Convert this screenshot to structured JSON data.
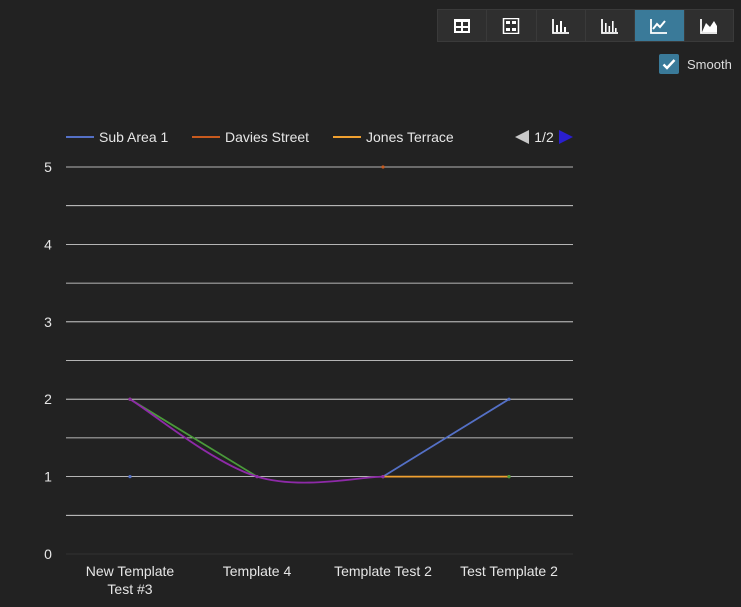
{
  "toolbar": {
    "buttons": [
      {
        "name": "table-view-button",
        "icon": "table-icon",
        "active": false
      },
      {
        "name": "pivot-view-button",
        "icon": "pivot-table-icon",
        "active": false
      },
      {
        "name": "bar-chart-button",
        "icon": "bar-chart-icon",
        "active": false
      },
      {
        "name": "column-chart-button",
        "icon": "column-chart-icon",
        "active": false
      },
      {
        "name": "line-chart-button",
        "icon": "line-chart-icon",
        "active": true
      },
      {
        "name": "area-chart-button",
        "icon": "area-chart-icon",
        "active": false
      }
    ],
    "active_color": "#3a7a99"
  },
  "smooth": {
    "label": "Smooth",
    "checked": true
  },
  "legend": {
    "page_label": "1/2"
  },
  "chart_data": {
    "type": "line",
    "title": "",
    "xlabel": "",
    "ylabel": "",
    "categories": [
      "New Template Test #3",
      "Template 4",
      "Template Test 2",
      "Test Template 2"
    ],
    "category_lines": [
      [
        "New Template",
        "Test #3"
      ],
      [
        "Template 4"
      ],
      [
        "Template Test 2"
      ],
      [
        "Test Template 2"
      ]
    ],
    "ylim": [
      0,
      5
    ],
    "yticks": [
      0,
      1,
      2,
      3,
      4,
      5
    ],
    "grid": true,
    "smooth": true,
    "legend_position": "top",
    "series": [
      {
        "name": "Sub Area 1",
        "color": "#5470c6",
        "values": [
          1,
          null,
          1,
          2
        ]
      },
      {
        "name": "Davies Street",
        "color": "#c85a1e",
        "values": [
          2,
          null,
          5,
          null
        ]
      },
      {
        "name": "Jones Terrace",
        "color": "#f0a030",
        "values": [
          null,
          null,
          1,
          1
        ]
      },
      {
        "color": "#4a9a3a",
        "values": [
          2,
          1,
          null,
          1
        ]
      },
      {
        "color": "#8e2aa8",
        "values": [
          2,
          1,
          1,
          null
        ]
      }
    ]
  }
}
